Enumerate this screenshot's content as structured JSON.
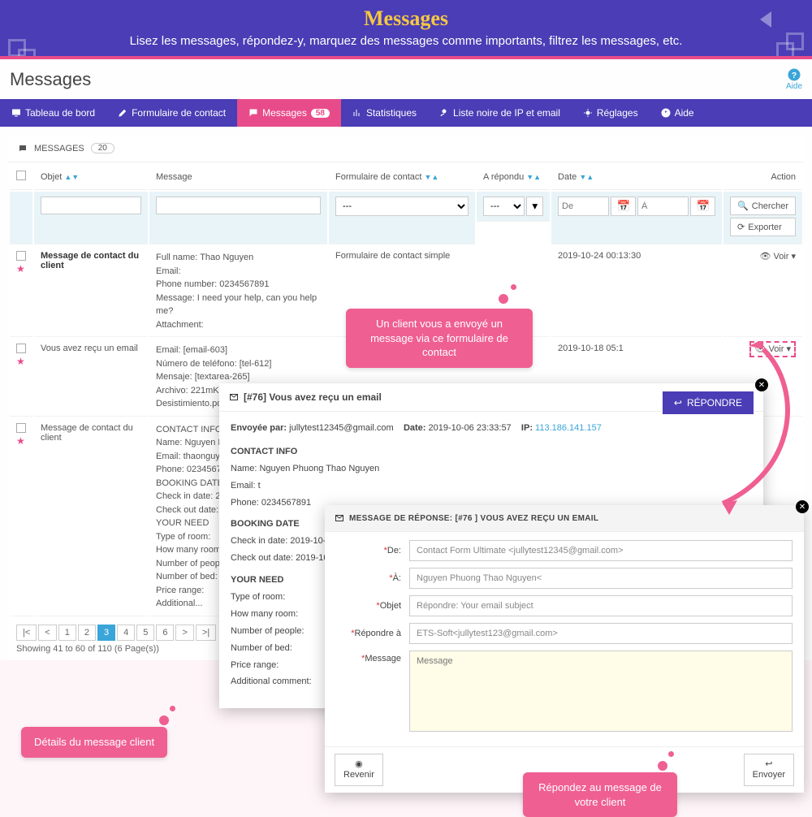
{
  "banner": {
    "title": "Messages",
    "subtitle": "Lisez les messages, répondez-y, marquez des messages comme importants, filtrez les messages, etc."
  },
  "page_title": "Messages",
  "help_label": "Aide",
  "tabs": [
    {
      "icon": "monitor",
      "label": "Tableau de bord"
    },
    {
      "icon": "edit",
      "label": "Formulaire de contact"
    },
    {
      "icon": "comments",
      "label": "Messages",
      "badge": "58",
      "active": true
    },
    {
      "icon": "chart",
      "label": "Statistiques"
    },
    {
      "icon": "userx",
      "label": "Liste noire de IP et email"
    },
    {
      "icon": "gear",
      "label": "Réglages"
    },
    {
      "icon": "question",
      "label": "Aide"
    }
  ],
  "panel": {
    "title": "MESSAGES",
    "count": "20"
  },
  "columns": {
    "objet": "Objet",
    "message": "Message",
    "form": "Formulaire de contact",
    "replied": "A répondu",
    "date": "Date",
    "action": "Action"
  },
  "filters": {
    "dash": "---",
    "de": "De",
    "a": "À",
    "chercher": "Chercher",
    "exporter": "Exporter"
  },
  "rows": [
    {
      "objet": "Message de contact du client",
      "bold": true,
      "lines": [
        "Full name: Thao Nguyen",
        "Email: ",
        "Phone number: 0234567891",
        "Message: I need your help, can you help me?",
        "Attachment:"
      ],
      "form": "Formulaire de contact simple",
      "date": "2019-10-24 00:13:30",
      "voir": "Voir"
    },
    {
      "objet": "Vous avez reçu un email",
      "lines": [
        "Email: [email-603]",
        "Número de teléfono: [tel-612]",
        "Mensaje: [textarea-265]",
        "Archivo: 221mKWv-1.-ANEXO-Derecho-",
        "Desistimiento.pdf"
      ],
      "date": "2019-10-18 05:1",
      "voir": "Voir",
      "dashed": true
    },
    {
      "objet": "Message de contact du client",
      "lines": [
        "CONTACT INFO",
        "Name: Nguyen Phuo",
        "Email: thaonguyencu",
        "Phone: 0234567891",
        "",
        "BOOKING DATE",
        "Check in date: 2019-1",
        "Check out date: 2019",
        "",
        "YOUR NEED",
        "Type of room:",
        "How many room:",
        "Number of people:",
        "Number of bed:",
        "Price range:",
        "Additional..."
      ]
    }
  ],
  "pager": {
    "buttons": [
      "|<",
      "<",
      "1",
      "2",
      "3",
      "4",
      "5",
      "6",
      ">",
      ">|"
    ],
    "current": "3",
    "text": "Showing 41 to 60 of 110 (6 Page(s))"
  },
  "modal1": {
    "title": "[#76] Vous avez reçu un email",
    "reply": "RÉPONDRE",
    "sent_by_label": "Envoyée par:",
    "sent_by": "jullytest12345@gmail.com",
    "date_label": "Date:",
    "date": "2019-10-06 23:33:57",
    "ip_label": "IP:",
    "ip": "113.186.141.157",
    "sections": [
      "CONTACT INFO",
      "Name: Nguyen Phuong Thao Nguyen",
      "Email: t",
      "Phone: 0234567891",
      "BOOKING DATE",
      "Check in date: 2019-10-07",
      "Check out date: 2019-10-08",
      "YOUR NEED",
      "Type of room:",
      "How many room:",
      "Number of people:",
      "Number of bed:",
      "Price range:",
      "Additional comment:"
    ]
  },
  "modal2": {
    "title": "MESSAGE DE RÉPONSE: [#76 ] VOUS AVEZ REÇU UN EMAIL",
    "fields": {
      "de": {
        "label": "De:",
        "value": "Contact Form Ultimate <jullytest12345@gmail.com>"
      },
      "a": {
        "label": "À:",
        "value": "Nguyen Phuong Thao Nguyen<"
      },
      "objet": {
        "label": "Objet",
        "value": "Répondre: Your email subject"
      },
      "repondre": {
        "label": "Répondre à",
        "value": "ETS-Soft<jullytest123@gmail.com>"
      },
      "message": {
        "label": "Message",
        "placeholder": "Message"
      }
    },
    "back": "Revenir",
    "send": "Envoyer"
  },
  "callouts": {
    "c1": "Un client vous a envoyé un message via ce formulaire de contact",
    "c2": "Détails du message client",
    "c3": "Répondez au message de votre client"
  }
}
